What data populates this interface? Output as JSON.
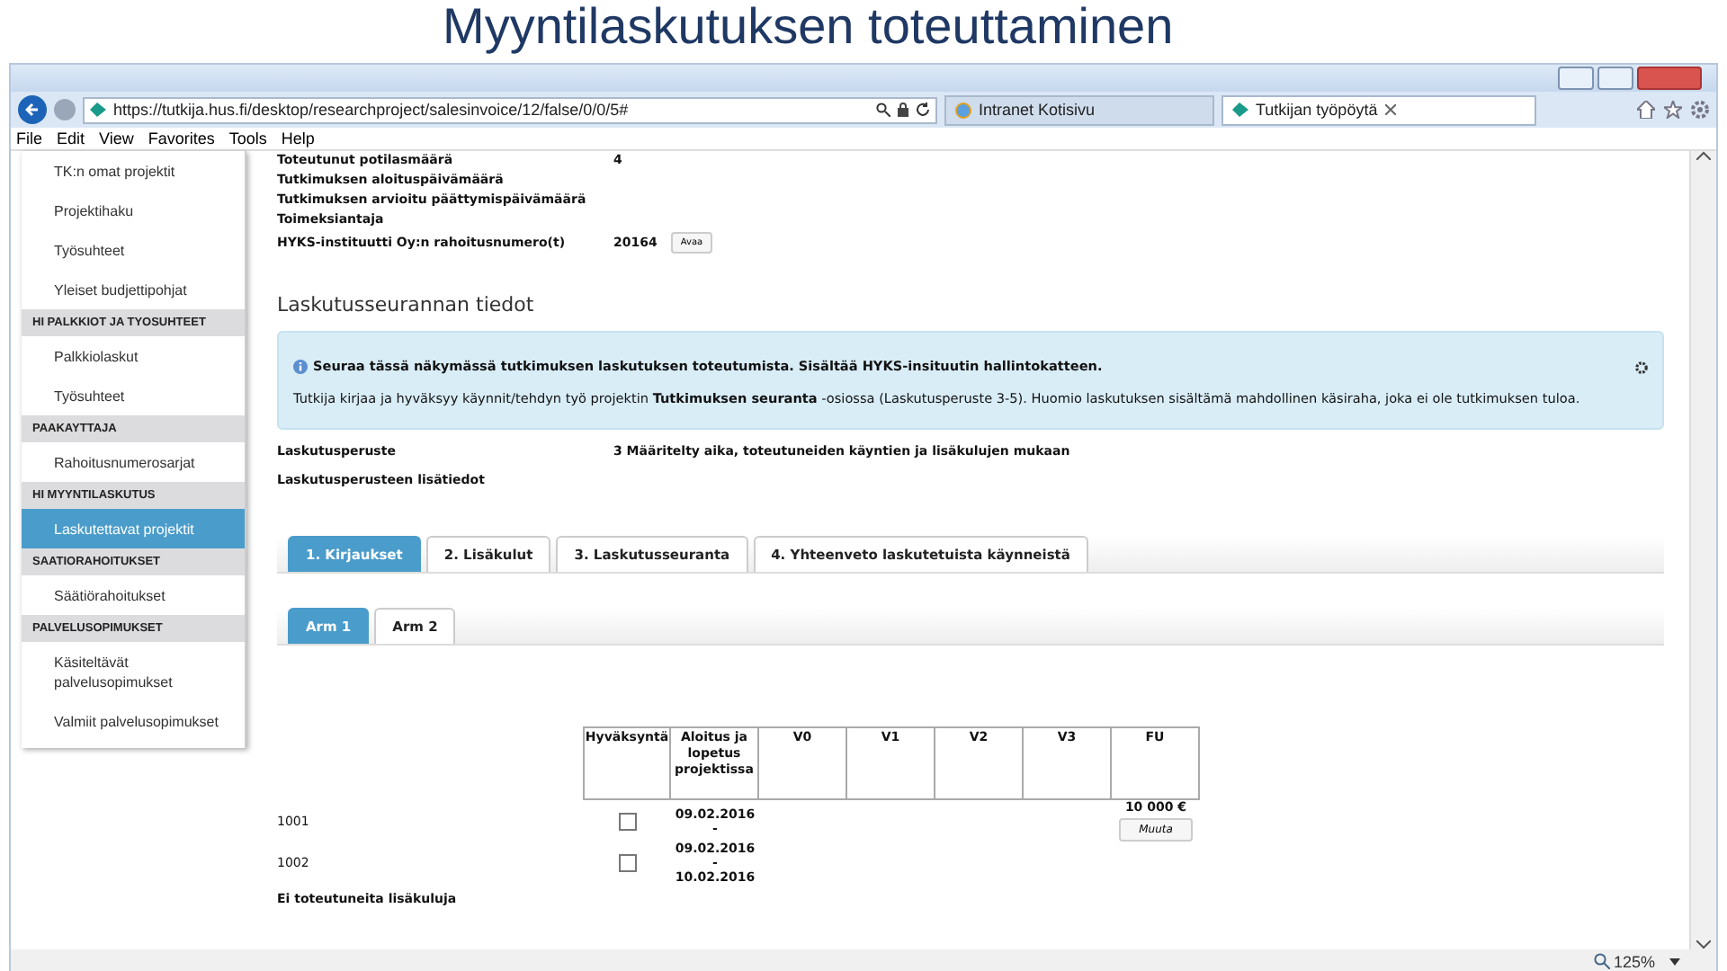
{
  "slide_title": "Myyntilaskutuksen toteuttaminen",
  "browser": {
    "url": "https://tutkija.hus.fi/desktop/researchproject/salesinvoice/12/false/0/0/5#",
    "tabs": [
      {
        "label": "Intranet Kotisivu",
        "selected": false
      },
      {
        "label": "Tutkijan työpöytä",
        "selected": true
      }
    ],
    "menu": [
      "File",
      "Edit",
      "View",
      "Favorites",
      "Tools",
      "Help"
    ],
    "zoom": "125%"
  },
  "sidebar": {
    "items": [
      {
        "kind": "link",
        "label": "TK:n omat projektit",
        "selected": false
      },
      {
        "kind": "link",
        "label": "Projektihaku",
        "selected": false
      },
      {
        "kind": "link",
        "label": "Työsuhteet",
        "selected": false
      },
      {
        "kind": "link",
        "label": "Yleiset budjettipohjat",
        "selected": false
      },
      {
        "kind": "header",
        "label": "HI PALKKIOT JA TYOSUHTEET"
      },
      {
        "kind": "link",
        "label": "Palkkiolaskut",
        "selected": false
      },
      {
        "kind": "link",
        "label": "Työsuhteet",
        "selected": false
      },
      {
        "kind": "header",
        "label": "PAAKAYTTAJA"
      },
      {
        "kind": "link",
        "label": "Rahoitusnumerosarjat",
        "selected": false
      },
      {
        "kind": "header",
        "label": "HI MYYNTILASKUTUS"
      },
      {
        "kind": "link",
        "label": "Laskutettavat projektit",
        "selected": true
      },
      {
        "kind": "header",
        "label": "SAATIORAHOITUKSET"
      },
      {
        "kind": "link",
        "label": "Säätiörahoitukset",
        "selected": false
      },
      {
        "kind": "header",
        "label": "PALVELUSOPIMUKSET"
      },
      {
        "kind": "link",
        "label": "Käsiteltävät palvelusopimukset",
        "selected": false
      },
      {
        "kind": "link",
        "label": "Valmiit palvelusopimukset",
        "selected": false
      }
    ]
  },
  "project_fields": [
    {
      "label": "Toteutunut potilasmäärä",
      "value": "4"
    },
    {
      "label": "Tutkimuksen aloituspäivämäärä"
    },
    {
      "label": "Tutkimuksen arvioitu päättymispäivämäärä"
    },
    {
      "label": "Toimeksiantaja"
    },
    {
      "label": "HYKS-instituutti Oy:n rahoitusnumero(t)",
      "value": "20164",
      "button": "Avaa"
    }
  ],
  "section_title": "Laskutusseurannan tiedot",
  "info": {
    "title": "Seuraa tässä näkymässä tutkimuksen laskutuksen toteutumista. Sisältää HYKS-insituutin hallintokatteen.",
    "text": "Tutkija kirjaa ja hyväksyy käynnit/tehdyn työ projektin **Tutkimuksen seuranta** -osiossa (Laskutusperuste 3-5). Huomio laskutuksen sisältämä mahdollinen käsiraha, joka ei ole tutkimuksen tuloa."
  },
  "billing_fields": [
    {
      "label": "Laskutusperuste",
      "value": "3 Määritelty aika, toteutuneiden käyntien ja lisäkulujen mukaan"
    },
    {
      "label": "Laskutusperusteen lisätiedot"
    }
  ],
  "tabs": [
    {
      "label": "1. Kirjaukset",
      "selected": true
    },
    {
      "label": "2. Lisäkulut",
      "selected": false
    },
    {
      "label": "3. Laskutusseuranta",
      "selected": false
    },
    {
      "label": "4. Yhteenveto laskutetuista käynneistä",
      "selected": false
    }
  ],
  "arm_tabs": [
    {
      "label": "Arm 1",
      "selected": true
    },
    {
      "label": "Arm 2",
      "selected": false
    }
  ],
  "table": {
    "columns": [
      "Hyväksyntä",
      "Aloitus ja lopetus projektissa",
      "V0",
      "V1",
      "V2",
      "V3",
      "FU"
    ],
    "rows": [
      {
        "id": "1001",
        "checked": false,
        "dates": "09.02.2016 -",
        "fu_amount": "10 000 €",
        "fu_button": "Muuta"
      },
      {
        "id": "1002",
        "checked": false,
        "dates": "09.02.2016 - 10.02.2016"
      }
    ],
    "note": "Ei toteutuneita lisäkuluja"
  }
}
